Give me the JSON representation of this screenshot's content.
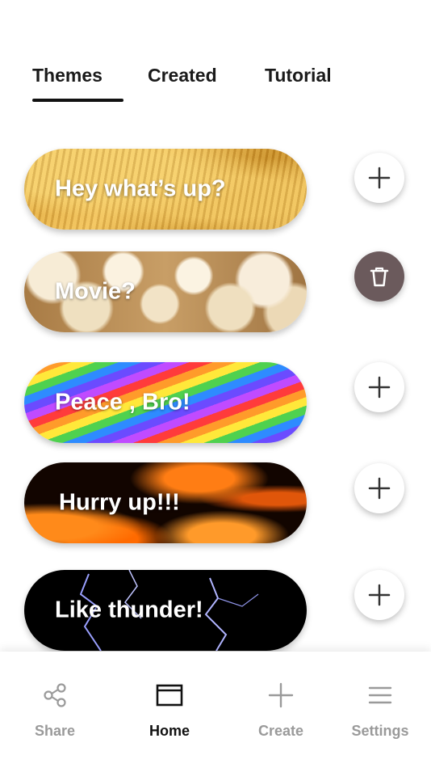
{
  "tabs": [
    {
      "label": "Themes",
      "active": true
    },
    {
      "label": "Created",
      "active": false
    },
    {
      "label": "Tutorial",
      "active": false
    }
  ],
  "cards": [
    {
      "label": "Hey what’s up?",
      "background": "potato-chips",
      "action": "add"
    },
    {
      "label": "Movie?",
      "background": "popcorn",
      "action": "delete"
    },
    {
      "label": "Peace , Bro!",
      "background": "rainbow",
      "action": "add"
    },
    {
      "label": "Hurry up!!!",
      "background": "fire",
      "action": "add"
    },
    {
      "label": "Like thunder!",
      "background": "thunder",
      "action": "add"
    }
  ],
  "icons": {
    "add": "plus-icon",
    "delete": "trash-icon"
  },
  "bottom_nav": [
    {
      "label": "Share",
      "icon": "share-icon",
      "active": false
    },
    {
      "label": "Home",
      "icon": "home-icon",
      "active": true
    },
    {
      "label": "Create",
      "icon": "plus-icon",
      "active": false
    },
    {
      "label": "Settings",
      "icon": "menu-icon",
      "active": false
    }
  ],
  "colors": {
    "active_text": "#111111",
    "inactive_text": "#9a9a9a",
    "trash_button": "#6b5a5c"
  }
}
